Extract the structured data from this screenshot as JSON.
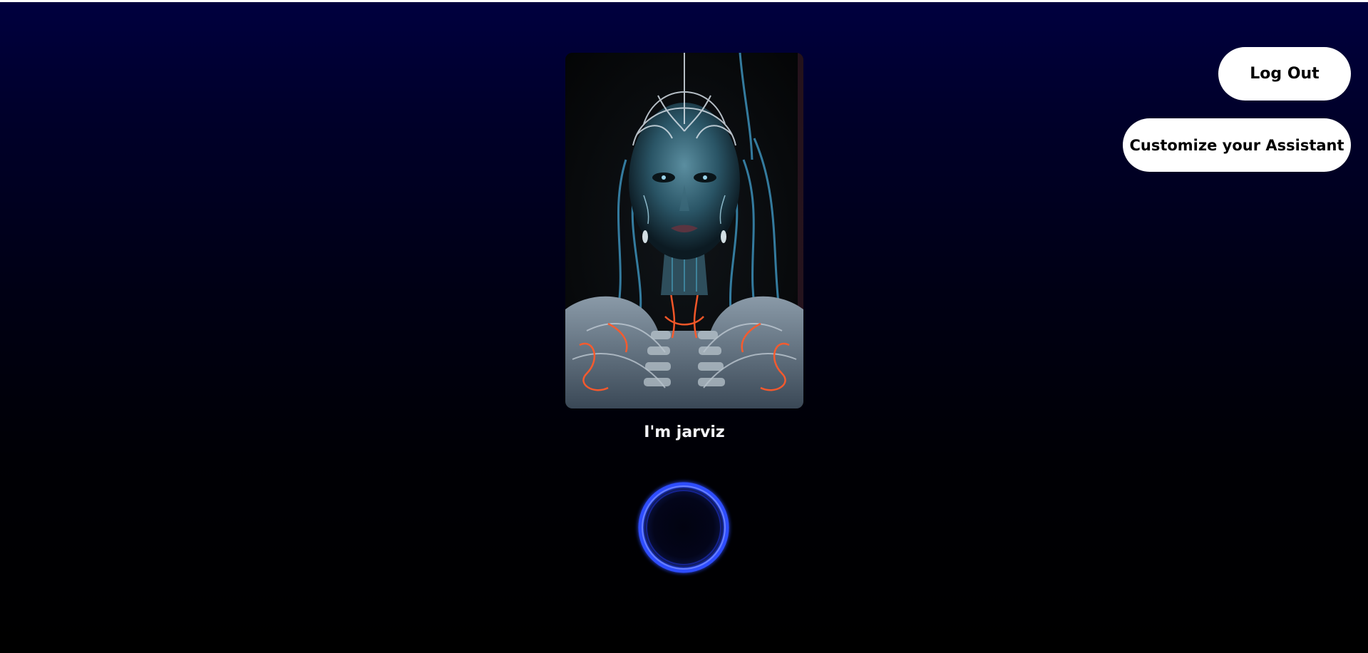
{
  "header": {
    "logout_label": "Log Out",
    "customize_label": "Customize your Assistant"
  },
  "assistant": {
    "greeting": "I'm jarviz",
    "portrait_icon": "cyborg-portrait-image",
    "mic_icon": "voice-orb-icon"
  },
  "colors": {
    "background_top": "#00003f",
    "background_bottom": "#000000",
    "button_bg": "#ffffff",
    "button_text": "#000000",
    "orb_ring": "#2f4dff",
    "neon_orange": "#ff5a2a",
    "neon_cyan": "#3fb6d8"
  }
}
